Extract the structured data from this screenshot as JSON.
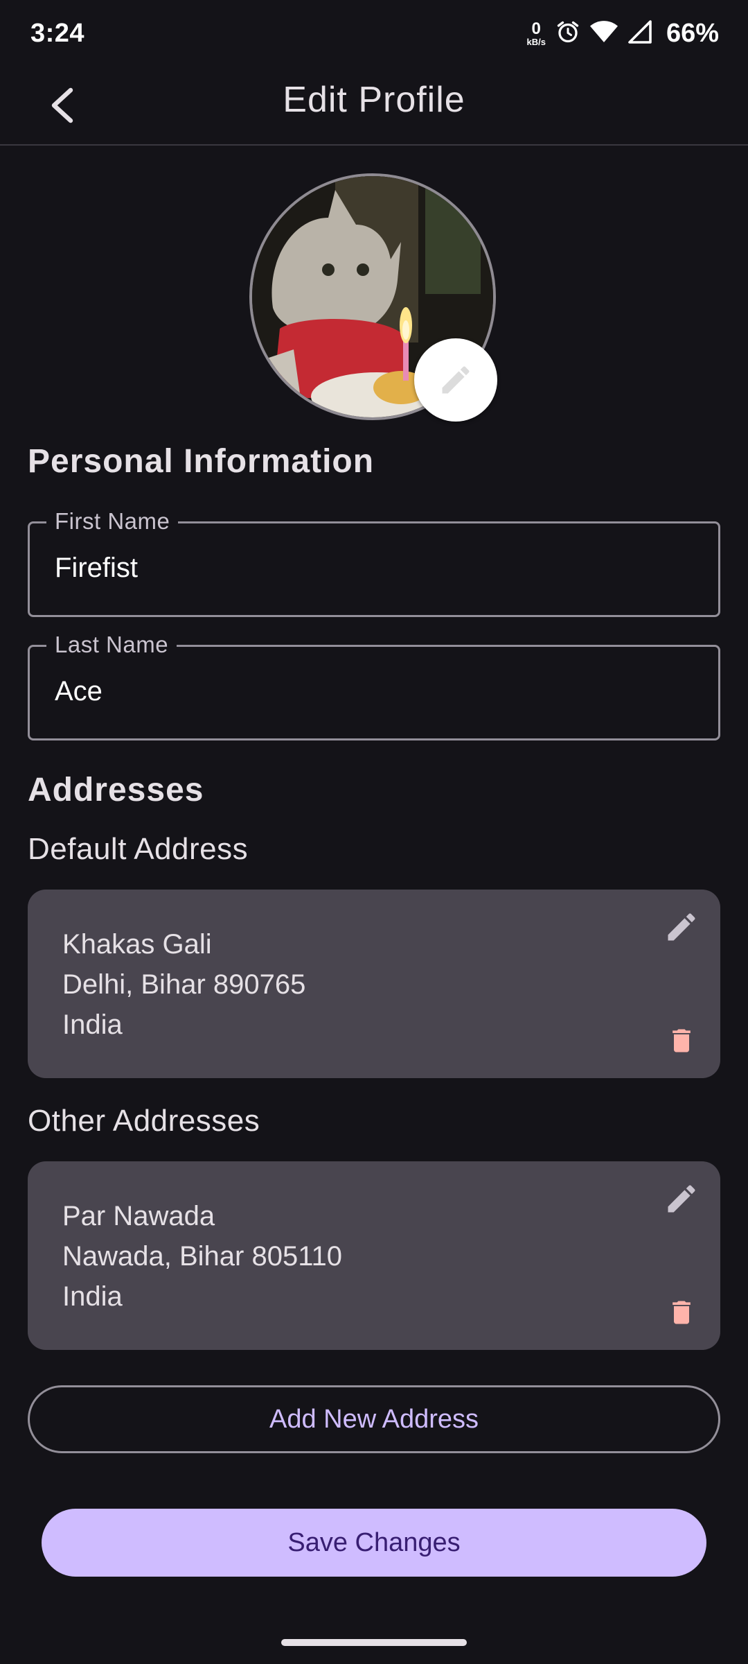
{
  "status_bar": {
    "time": "3:24",
    "net_speed": "0",
    "net_unit": "kB/s",
    "battery": "66%"
  },
  "header": {
    "title": "Edit Profile"
  },
  "personal": {
    "section_title": "Personal Information",
    "first_name_label": "First Name",
    "first_name_value": "Firefist",
    "last_name_label": "Last Name",
    "last_name_value": "Ace"
  },
  "addresses": {
    "section_title": "Addresses",
    "default_title": "Default Address",
    "default": {
      "line1": "Khakas Gali",
      "line2": "Delhi, Bihar 890765",
      "line3": "India"
    },
    "other_title": "Other Addresses",
    "others": [
      {
        "line1": "Par Nawada",
        "line2": "Nawada, Bihar 805110",
        "line3": "India"
      }
    ]
  },
  "buttons": {
    "add_address": "Add New Address",
    "save": "Save Changes"
  },
  "colors": {
    "background": "#141318",
    "card": "#49454f",
    "primary": "#cfbcff",
    "delete": "#ffb4ab"
  }
}
